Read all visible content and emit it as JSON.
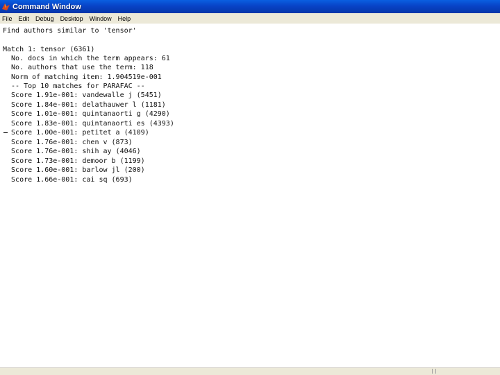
{
  "window": {
    "title": "Command Window",
    "icon": "matlab-icon"
  },
  "menu": [
    "File",
    "Edit",
    "Debug",
    "Desktop",
    "Window",
    "Help"
  ],
  "console": {
    "lines": [
      "Find authors similar to 'tensor'",
      "",
      "Match 1: tensor (6361)",
      "  No. docs in which the term appears: 61",
      "  No. authors that use the term: 118",
      "  Norm of matching item: 1.904519e-001",
      "  -- Top 10 matches for PARAFAC --",
      "  Score 1.91e-001: vandewalle j (5451)",
      "  Score 1.84e-001: delathauwer l (1181)",
      "  Score 1.01e-001: quintanaorti g (4290)",
      "  Score 1.83e-001: quintanaorti es (4393)",
      "  Score 1.00e-001: petitet a (4109)",
      "  Score 1.76e-001: chen v (873)",
      "  Score 1.76e-001: shih ay (4046)",
      "  Score 1.73e-001: demoor b (1199)",
      "  Score 1.60e-001: barlow jl (200)",
      "  Score 1.66e-001: cai sq (693)"
    ]
  }
}
